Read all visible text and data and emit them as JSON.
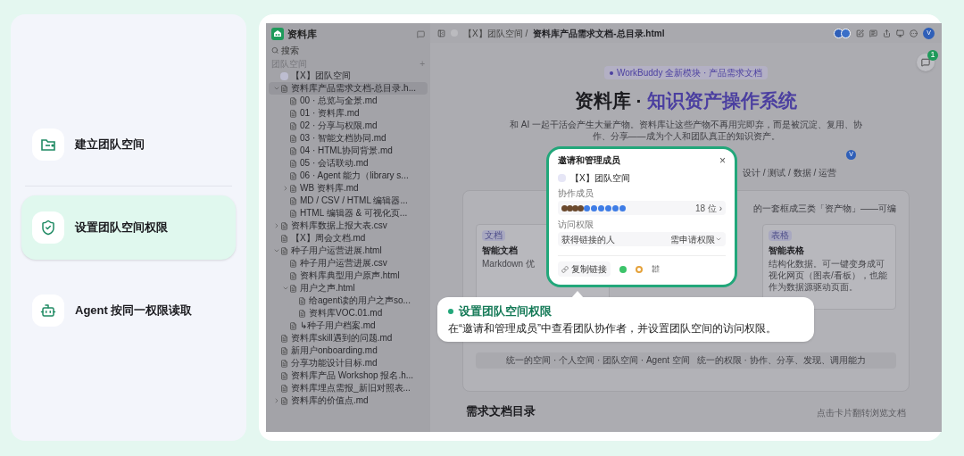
{
  "steps": [
    {
      "kind": "folder",
      "label": "建立团队空间",
      "selected": false
    },
    {
      "kind": "shield",
      "label": "设置团队空间权限",
      "selected": true
    },
    {
      "kind": "robot",
      "label": "Agent 按同一权限读取",
      "selected": false
    }
  ],
  "app": {
    "sidebar": {
      "title": "资料库",
      "search": {
        "placeholder": "搜索"
      },
      "section": "团队空间",
      "add": "+",
      "items": [
        {
          "kind": "space",
          "label": "【X】团队空间",
          "selected": false
        },
        {
          "kind": "doc",
          "label": "资料库产品需求文档-总目录.h...",
          "selected": true,
          "expanded": true,
          "children": [
            {
              "kind": "doc",
              "label": "00 · 总览与全景.md",
              "selected": false
            },
            {
              "kind": "doc",
              "label": "01 · 资料库.md",
              "selected": false
            },
            {
              "kind": "doc",
              "label": "02 · 分享与权限.md",
              "selected": false
            },
            {
              "kind": "doc",
              "label": "03 · 智能文档协同.md",
              "selected": false
            },
            {
              "kind": "doc",
              "label": "04 · HTML协同背景.md",
              "selected": false
            },
            {
              "kind": "doc",
              "label": "05 · 会话联动.md",
              "selected": false
            },
            {
              "kind": "doc",
              "label": "06 · Agent 能力（library s...",
              "selected": false
            },
            {
              "kind": "doc",
              "label": "WB 资料库.md",
              "selected": false,
              "expanded": false
            },
            {
              "kind": "doc",
              "label": "MD / CSV / HTML 编辑器...",
              "selected": false
            },
            {
              "kind": "doc",
              "label": "HTML 编辑器 & 可视化页...",
              "selected": false
            }
          ]
        },
        {
          "kind": "doc",
          "label": "资料库数据上报大表.csv",
          "selected": false,
          "expanded": false
        },
        {
          "kind": "doc",
          "label": "【X】周会文档.md",
          "selected": false
        },
        {
          "kind": "doc",
          "label": "种子用户运营进展.html",
          "selected": false,
          "expanded": true,
          "children": [
            {
              "kind": "doc",
              "label": "种子用户运营进展.csv",
              "selected": false
            },
            {
              "kind": "doc",
              "label": "资料库典型用户原声.html",
              "selected": false
            },
            {
              "kind": "doc",
              "label": "用户之声.html",
              "selected": false,
              "expanded": true,
              "children": [
                {
                  "kind": "doc",
                  "label": "给agent读的用户之声so...",
                  "selected": false
                },
                {
                  "kind": "doc",
                  "label": "资料库VOC.01.md",
                  "selected": false
                }
              ]
            },
            {
              "kind": "doc",
              "label": "↳种子用户档案.md",
              "selected": false
            }
          ]
        },
        {
          "kind": "doc",
          "label": "资料库skill遇到的问题.md",
          "selected": false
        },
        {
          "kind": "doc",
          "label": "新用户onboarding.md",
          "selected": false
        },
        {
          "kind": "doc",
          "label": "分享功能设计目标.md",
          "selected": false
        },
        {
          "kind": "doc",
          "label": "资料库产品 Workshop 报名.h...",
          "selected": false
        },
        {
          "kind": "doc",
          "label": "资料库埋点需报_新旧对照表...",
          "selected": false
        },
        {
          "kind": "doc",
          "label": "资料库的价值点.md",
          "selected": false,
          "expanded": false
        }
      ]
    },
    "topbar": {
      "breadcrumb": "【X】团队空间 /",
      "current": "资料库产品需求文档-总目录.html",
      "user": "V"
    },
    "comment_count": "1",
    "hero": {
      "badge": "WorkBuddy 全新模块 · 产品需求文档",
      "title": "资料库 · ",
      "title_accent": "知识资产操作系统",
      "subtitle": "和 AI 一起干活会产生大量产物。资料库让这些产物不再用完即弃，而是被沉淀、复用、协作、分享——成为个人和团队真正的知识资产。",
      "viewer": "V",
      "roles": "设计 / 测试 / 数据 / 运营"
    },
    "overview": {
      "note": "的一套框成三类「资产物」——可编",
      "cards": [
        {
          "tag": "文档",
          "title": "智能文档",
          "desc": "Markdown 优"
        },
        {
          "tag": "表格",
          "title": "智能表格",
          "desc": "结构化数据。可一键变身成可视化网页（图表/看板），也能作为数据源驱动页面。"
        }
      ],
      "footer": [
        "统一的空间 · 个人空间 · 团队空间 · Agent 空间",
        "统一的权限 · 协作、分享、发现、调用能力"
      ]
    },
    "toc": {
      "title": "需求文档目录",
      "hint": "点击卡片翻转浏览文档"
    },
    "modal": {
      "title": "邀请和管理成员",
      "close": "×",
      "space": "【X】团队空间",
      "members_label": "协作成员",
      "member_count": "18 位 ›",
      "access_label": "访问权限",
      "access_who": "获得链接的人",
      "access_level": "需申请权限",
      "copy_link": "复制链接"
    },
    "callout": {
      "title": "设置团队空间权限",
      "desc": "在“邀请和管理成员”中查看团队协作者，并设置团队空间的访问权限。"
    }
  }
}
